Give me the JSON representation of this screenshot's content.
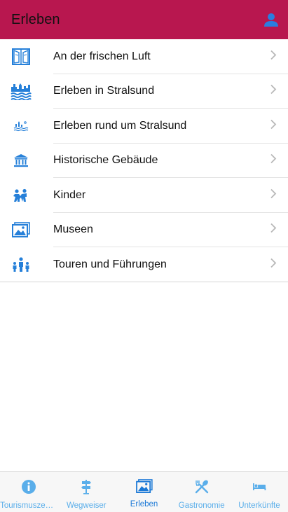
{
  "header": {
    "title": "Erleben",
    "user_icon": "user-icon"
  },
  "list": [
    {
      "label": "An der frischen Luft",
      "icon": "window-icon"
    },
    {
      "label": "Erleben in Stralsund",
      "icon": "city-water-icon"
    },
    {
      "label": "Erleben rund um Stralsund",
      "icon": "harbor-icon"
    },
    {
      "label": "Historische Gebäude",
      "icon": "building-columns-icon"
    },
    {
      "label": "Kinder",
      "icon": "children-icon"
    },
    {
      "label": "Museen",
      "icon": "picture-icon"
    },
    {
      "label": "Touren und Führungen",
      "icon": "group-icon"
    }
  ],
  "tabbar": {
    "tabs": [
      {
        "label": "Tourismuszentrale",
        "icon": "info-icon"
      },
      {
        "label": "Wegweiser",
        "icon": "signpost-icon"
      },
      {
        "label": "Erleben",
        "icon": "picture-icon",
        "active": true
      },
      {
        "label": "Gastronomie",
        "icon": "cutlery-icon"
      },
      {
        "label": "Unterkünfte",
        "icon": "bed-icon"
      }
    ]
  },
  "colors": {
    "header": "#b8174f",
    "accent": "#1a78d6",
    "tab_inactive": "#5aaeea",
    "icon": "#2680d9"
  }
}
